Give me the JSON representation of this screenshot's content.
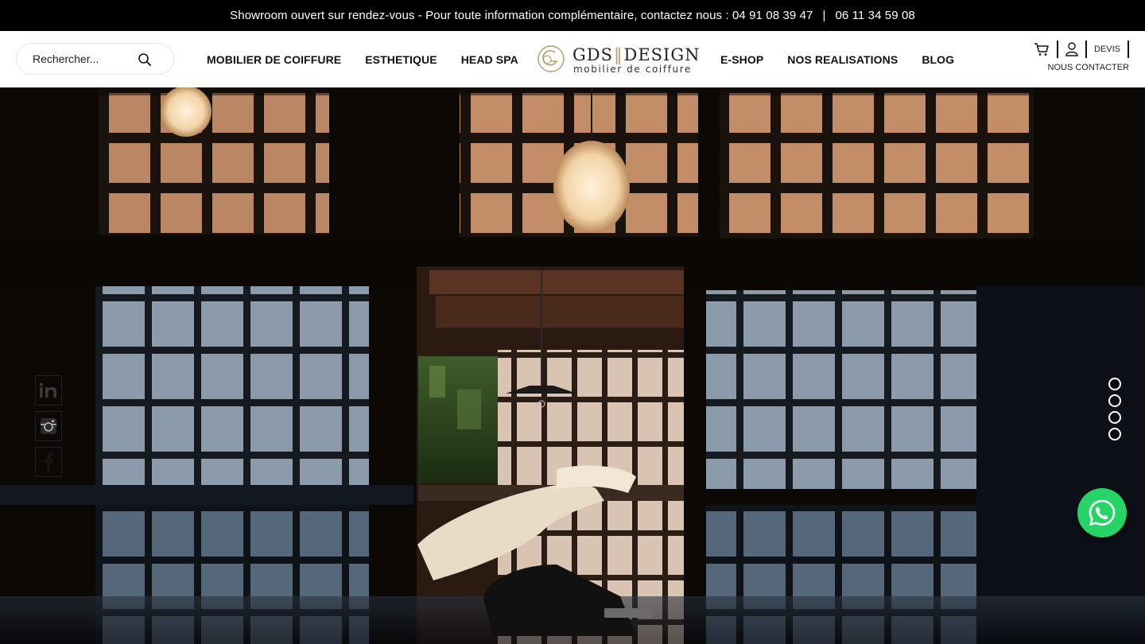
{
  "announcement": {
    "text": "Showroom ouvert sur rendez-vous - Pour toute information complémentaire, contactez nous : 04 91 08 39 47",
    "separator": "|",
    "phone2": "06 11 34 59 08"
  },
  "search": {
    "placeholder": "Rechercher..."
  },
  "nav": {
    "left": [
      "MOBILIER DE COIFFURE",
      "ESTHETIQUE",
      "HEAD SPA"
    ],
    "right": [
      "E-SHOP",
      "NOS REALISATIONS",
      "BLOG"
    ]
  },
  "logo": {
    "brand_left": "GDS",
    "brand_right": "DESIGN",
    "tagline": "mobilier de coiffure"
  },
  "utilities": {
    "devis": "DEVIS",
    "contact": "NOUS CONTACTER"
  },
  "social": [
    "linkedin-icon",
    "instagram-icon",
    "facebook-icon"
  ],
  "slider": {
    "dot_count": 4
  },
  "colors": {
    "accent_gold": "#b89a6a",
    "whatsapp": "#25d366",
    "topbar": "#000000"
  }
}
